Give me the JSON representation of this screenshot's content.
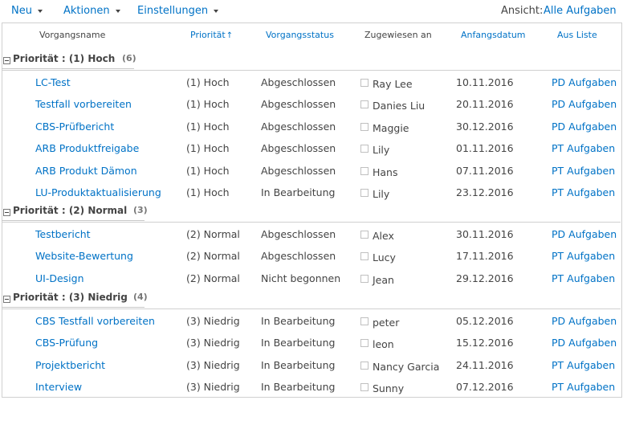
{
  "toolbar": {
    "new_label": "Neu",
    "actions_label": "Aktionen",
    "settings_label": "Einstellungen",
    "view_label": "Ansicht:",
    "view_value": "Alle Aufgaben"
  },
  "columns": {
    "name": "Vorgangsname",
    "priority": "Priorität",
    "priority_sort": "↑",
    "status": "Vorgangsstatus",
    "assigned": "Zugewiesen an",
    "start": "Anfangsdatum",
    "list": "Aus Liste"
  },
  "groups": [
    {
      "title": "Priorität : (1) Hoch",
      "count": "(6)",
      "rows": [
        {
          "name": "LC-Test",
          "priority": "(1) Hoch",
          "status": "Abgeschlossen",
          "assigned": "Ray Lee",
          "start": "10.11.2016",
          "list": "PD Aufgaben"
        },
        {
          "name": "Testfall vorbereiten",
          "priority": "(1) Hoch",
          "status": "Abgeschlossen",
          "assigned": "Danies Liu",
          "start": "20.11.2016",
          "list": "PD Aufgaben"
        },
        {
          "name": "CBS-Prüfbericht",
          "priority": "(1) Hoch",
          "status": "Abgeschlossen",
          "assigned": "Maggie",
          "start": "30.12.2016",
          "list": "PD Aufgaben"
        },
        {
          "name": "ARB Produktfreigabe",
          "priority": "(1) Hoch",
          "status": "Abgeschlossen",
          "assigned": "Lily",
          "start": "01.11.2016",
          "list": "PT Aufgaben"
        },
        {
          "name": "ARB Produkt Dämon",
          "priority": "(1) Hoch",
          "status": "Abgeschlossen",
          "assigned": "Hans",
          "start": "07.11.2016",
          "list": "PT Aufgaben"
        },
        {
          "name": "LU-Produktaktualisierung",
          "priority": "(1) Hoch",
          "status": "In Bearbeitung",
          "assigned": "Lily",
          "start": "23.12.2016",
          "list": "PT Aufgaben"
        }
      ]
    },
    {
      "title": "Priorität : (2) Normal",
      "count": "(3)",
      "rows": [
        {
          "name": "Testbericht",
          "priority": "(2) Normal",
          "status": "Abgeschlossen",
          "assigned": "Alex",
          "start": "30.11.2016",
          "list": "PD Aufgaben"
        },
        {
          "name": "Website-Bewertung",
          "priority": "(2) Normal",
          "status": "Abgeschlossen",
          "assigned": "Lucy",
          "start": "17.11.2016",
          "list": "PT Aufgaben"
        },
        {
          "name": "UI-Design",
          "priority": "(2) Normal",
          "status": "Nicht begonnen",
          "assigned": "Jean",
          "start": "29.12.2016",
          "list": "PT Aufgaben"
        }
      ]
    },
    {
      "title": "Priorität : (3) Niedrig",
      "count": "(4)",
      "rows": [
        {
          "name": "CBS Testfall vorbereiten",
          "priority": "(3) Niedrig",
          "status": "In Bearbeitung",
          "assigned": "peter",
          "start": "05.12.2016",
          "list": "PD Aufgaben"
        },
        {
          "name": "CBS-Prüfung",
          "priority": "(3) Niedrig",
          "status": "In Bearbeitung",
          "assigned": "leon",
          "start": "15.12.2016",
          "list": "PD Aufgaben"
        },
        {
          "name": "Projektbericht",
          "priority": "(3) Niedrig",
          "status": "In Bearbeitung",
          "assigned": "Nancy Garcia",
          "start": "24.11.2016",
          "list": "PT Aufgaben"
        },
        {
          "name": "Interview",
          "priority": "(3) Niedrig",
          "status": "In Bearbeitung",
          "assigned": "Sunny",
          "start": "07.12.2016",
          "list": "PT Aufgaben"
        }
      ]
    }
  ]
}
